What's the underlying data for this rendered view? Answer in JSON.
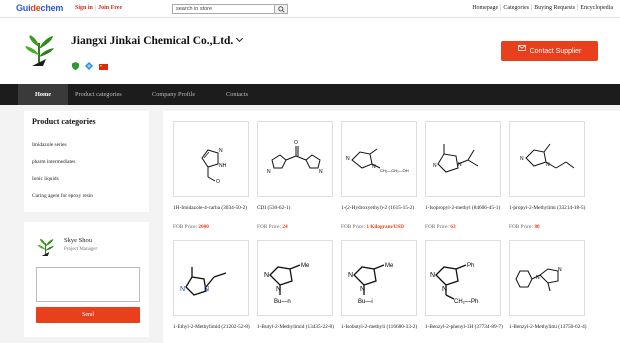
{
  "top": {
    "logo": {
      "part1": "Gui",
      "part2": "de",
      "part3": "chem"
    },
    "sign_in": "Sign in",
    "join_free": "Join Free",
    "search_placeholder": "search in store",
    "links": [
      "Homepage",
      "Categories",
      "Buying Requests",
      "Encyclopedia"
    ]
  },
  "company": {
    "name": "Jiangxi Jinkai Chemical Co.,Ltd.",
    "contact_label": "Contact Supplier"
  },
  "nav": {
    "items": [
      "Home",
      "Product categories",
      "Company Profile",
      "Contacts"
    ],
    "active": "Home"
  },
  "sidebar": {
    "title": "Product categories",
    "categories": [
      "Imidazole series",
      "pharm intermediates",
      "Ionic liquids",
      "Curing agent for epoxy resin"
    ]
  },
  "profile": {
    "name": "Skye Shou",
    "role": "Project Manager",
    "send_label": "Send"
  },
  "products": [
    {
      "name": "1H-Imidazole-4-carba (3034-50-2)",
      "price_label": "FOB Price:",
      "price": "2000"
    },
    {
      "name": "CDI (530-62-1)",
      "price_label": "FOB Price:",
      "price": "24"
    },
    {
      "name": "1-(2-Hydroxyethyl)-2 (1615-15-2)",
      "price_label": "FOB Price:",
      "price": "1 Kilogram/USD"
    },
    {
      "name": "1-Isopropyl-2-methyl (84606-45-1)",
      "price_label": "FOB Price:",
      "price": "63"
    },
    {
      "name": "1-propyl-2-Methylimi (33214-18-5)",
      "price_label": "FOB Price:",
      "price": "80"
    },
    {
      "name": "1-Ethyl-2-Methylimid (21202-52-8)",
      "structure_labels": []
    },
    {
      "name": "1-Butyl-2-Methylimid (13435-22-8)",
      "structure_labels": [
        "Me",
        "Bu-n"
      ]
    },
    {
      "name": "1-Isobutyl-2-methyli (116680-33-2)",
      "structure_labels": [
        "Me",
        "Bu-i"
      ]
    },
    {
      "name": "1-Benzyl-2-phenyl-1H (37734-89-7)",
      "structure_labels": [
        "Ph",
        "CH2Ph"
      ]
    },
    {
      "name": "1-Benzyl-2-Methylimi (13750-62-4)",
      "structure_labels": []
    }
  ],
  "structure_text": {
    "p1_o": "O",
    "p2_o": "O",
    "p3_chain": "CH₂—CH₂—OH",
    "me": "Me",
    "ph": "Ph",
    "bu_n": "Bu—n",
    "bu_i": "Bu—i",
    "ch2ph": "CH₂—Ph",
    "n": "N"
  },
  "colors": {
    "accent": "#e8401c",
    "nav_bg": "#1c1c1c",
    "link_red": "#d42b1e",
    "logo_blue": "#2a5bd7"
  }
}
